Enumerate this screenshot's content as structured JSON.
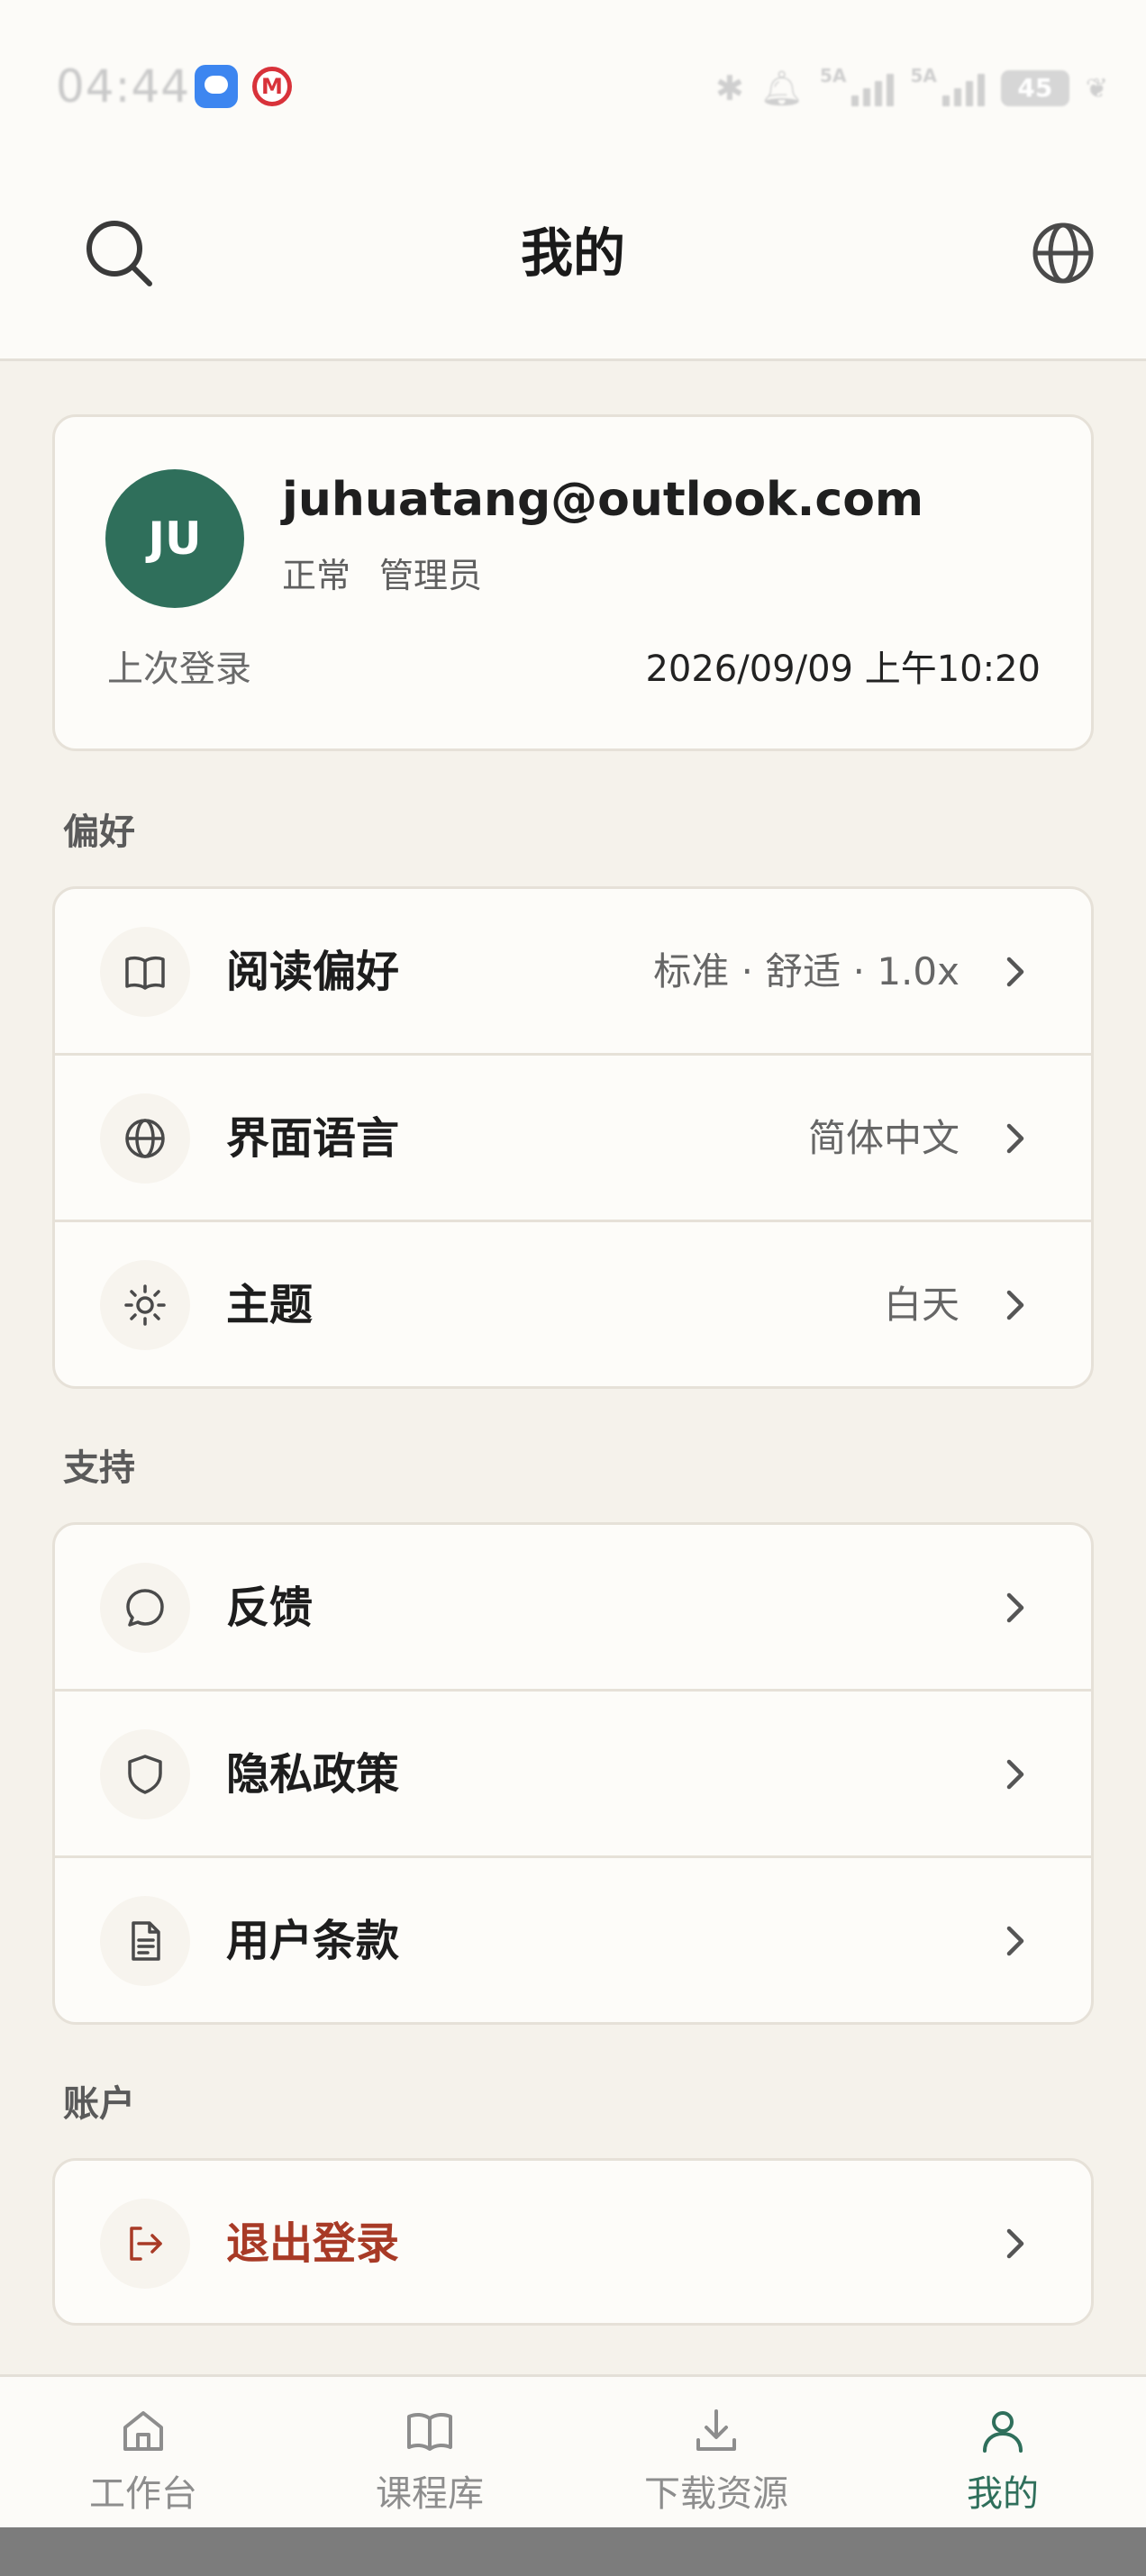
{
  "status_bar": {
    "time": "04:44",
    "network_1": "5A",
    "network_2": "5A",
    "battery": "45",
    "icons": [
      "message-app-icon",
      "bank-app-icon",
      "bluetooth-icon",
      "mute-bell-icon",
      "signal-icon",
      "signal-icon",
      "battery-icon",
      "leaf-icon"
    ]
  },
  "header": {
    "title": "我的",
    "left_icon": "search-icon",
    "right_icon": "globe-icon"
  },
  "profile": {
    "avatar_initials": "JU",
    "email": "juhuatang@outlook.com",
    "status": "正常",
    "role": "管理员",
    "last_login_label": "上次登录",
    "last_login_value": "2026/09/09 上午10:20",
    "avatar_color": "#2f6f5b"
  },
  "preferences": {
    "title": "偏好",
    "items": [
      {
        "icon": "book-icon",
        "label": "阅读偏好",
        "value": "标准 · 舒适 · 1.0x"
      },
      {
        "icon": "globe-icon",
        "label": "界面语言",
        "value": "简体中文"
      },
      {
        "icon": "sun-icon",
        "label": "主题",
        "value": "白天"
      }
    ]
  },
  "support": {
    "title": "支持",
    "items": [
      {
        "icon": "chat-bubble-icon",
        "label": "反馈"
      },
      {
        "icon": "shield-icon",
        "label": "隐私政策"
      },
      {
        "icon": "document-icon",
        "label": "用户条款"
      }
    ]
  },
  "account": {
    "title": "账户",
    "items": [
      {
        "icon": "logout-icon",
        "label": "退出登录",
        "color": "#a83a26"
      }
    ]
  },
  "bottom_nav": {
    "items": [
      {
        "icon": "home-icon",
        "label": "工作台",
        "active": false
      },
      {
        "icon": "book-icon",
        "label": "课程库",
        "active": false
      },
      {
        "icon": "download-icon",
        "label": "下载资源",
        "active": false
      },
      {
        "icon": "user-icon",
        "label": "我的",
        "active": true
      }
    ],
    "active_color": "#2f6f5b"
  }
}
